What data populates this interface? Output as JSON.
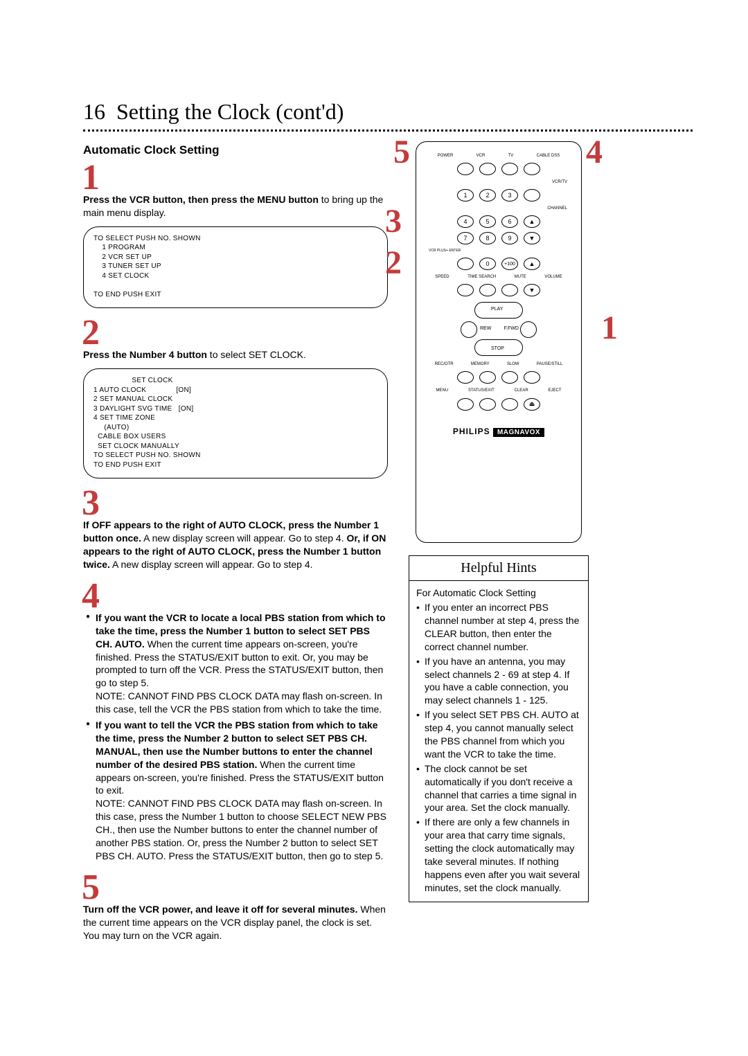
{
  "page": {
    "number": "16",
    "title": "Setting the Clock (cont'd)"
  },
  "section_title": "Automatic Clock Setting",
  "steps": {
    "s1": {
      "num": "1",
      "text_a": "Press the VCR button, then press the MENU button",
      "text_b": " to bring up the main menu display."
    },
    "osd1": "TO SELECT PUSH NO. SHOWN\n    1 PROGRAM\n    2 VCR SET UP\n    3 TUNER SET UP\n    4 SET CLOCK\n\nTO END PUSH EXIT",
    "s2": {
      "num": "2",
      "text_a": "Press the Number 4 button",
      "text_b": " to select SET CLOCK."
    },
    "osd2": "                  SET CLOCK\n1 AUTO CLOCK              [ON]\n2 SET MANUAL CLOCK\n3 DAYLIGHT SVG TIME   [ON]\n4 SET TIME ZONE\n     (AUTO)\n  CABLE BOX USERS\n  SET CLOCK MANUALLY\nTO SELECT PUSH NO. SHOWN\nTO END PUSH EXIT",
    "s3": {
      "num": "3",
      "text_a": "If OFF appears to the right of AUTO CLOCK, press the Number 1 button once.",
      "text_b": " A new display screen will appear. Go to step 4. ",
      "text_c": "Or, if ON appears to the right of AUTO CLOCK, press the Number 1 button twice.",
      "text_d": " A new display screen will appear. Go to step 4."
    },
    "s4": {
      "num": "4",
      "opt1_a": "If you want the VCR to locate a local PBS station from which to take the time, press the Number 1 button to select SET PBS CH. AUTO.",
      "opt1_b": " When the current time appears on-screen, you're finished. Press the STATUS/EXIT button to exit. Or, you may be prompted to turn off the VCR. Press the STATUS/EXIT button, then go to step 5.",
      "note1": "NOTE: CANNOT FIND PBS CLOCK DATA may flash on-screen. In this case, tell the VCR the PBS station from which to take the time.",
      "opt2_a": "If you want to tell the VCR the PBS station from which to take the time, press the Number 2 button to select SET PBS CH. MANUAL, then use the Number buttons to enter the channel number of the desired PBS station.",
      "opt2_b": " When the current time appears on-screen, you're finished. Press the STATUS/EXIT button to exit.",
      "note2": "NOTE: CANNOT FIND PBS CLOCK DATA may flash on-screen. In this case, press the Number 1 button to choose SELECT NEW PBS CH., then use the Number buttons to enter the channel number of another PBS station. Or, press the Number 2 button to select SET PBS CH. AUTO. Press the STATUS/EXIT button, then go to step 5."
    },
    "s5": {
      "num": "5",
      "text_a": "Turn off the VCR power, and leave it off for several minutes.",
      "text_b": " When the current time appears on the VCR display panel, the clock is set. You may turn on the VCR again."
    }
  },
  "callouts": {
    "c1": "1",
    "c2": "2",
    "c3": "3",
    "c4": "4",
    "c5": "5"
  },
  "remote": {
    "row0": {
      "a": "POWER",
      "b": "VCR",
      "c": "TV",
      "d": "CABLE DSS"
    },
    "d_label_vcrtv": "VCR/TV",
    "nums": {
      "1": "1",
      "2": "2",
      "3": "3",
      "4": "4",
      "5": "5",
      "6": "6",
      "7": "7",
      "8": "8",
      "9": "9",
      "0": "0",
      "p100": "+100"
    },
    "ch": "CHANNEL",
    "vcrplus": "VCR PLUS+ ENTER",
    "row_sp": {
      "a": "SPEED",
      "b": "TIME SEARCH",
      "c": "MUTE",
      "d": "VOLUME"
    },
    "play": {
      "play": "PLAY",
      "rew": "REW",
      "ffwd": "F.FWD",
      "stop": "STOP"
    },
    "row_rec": {
      "a": "REC/OTR",
      "b": "MEMORY",
      "c": "SLOW",
      "d": "PAUSE/STILL"
    },
    "row_menu": {
      "a": "MENU",
      "b": "STATUS/EXIT",
      "c": "CLEAR",
      "d": "EJECT"
    },
    "brand": "PHILIPS",
    "brand2": "MAGNAVOX"
  },
  "hints": {
    "title": "Helpful Hints",
    "lead": "For Automatic Clock Setting",
    "li1": "If you enter an incorrect PBS channel number at step 4, press the CLEAR button, then enter the correct channel number.",
    "li2": "If you have an antenna, you may select channels 2 - 69 at step 4. If you have a cable connection, you may select channels 1 - 125.",
    "li3": "If you select SET PBS CH. AUTO at step 4, you cannot manually select the PBS channel from which you want the VCR to take the time.",
    "li4": "The clock cannot be set automatically if you don't receive a channel that carries a time signal in your area. Set the clock manually.",
    "li5": "If there are only a few channels in your area that carry time signals, setting the clock automatically may take several minutes. If nothing happens even after you wait several minutes, set the clock manually."
  }
}
